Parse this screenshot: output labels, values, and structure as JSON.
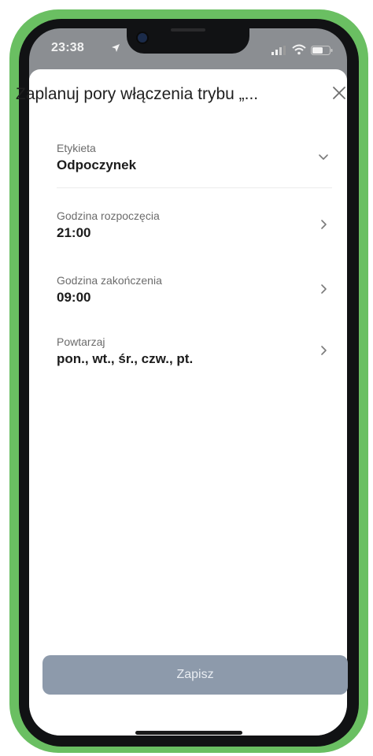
{
  "status_bar": {
    "time": "23:38"
  },
  "sheet": {
    "title": "Zaplanuj pory włączenia trybu „..."
  },
  "fields": [
    {
      "label": "Etykieta",
      "value": "Odpoczynek"
    },
    {
      "label": "Godzina rozpoczęcia",
      "value": "21:00"
    },
    {
      "label": "Godzina zakończenia",
      "value": "09:00"
    },
    {
      "label": "Powtarzaj",
      "value": "pon., wt., śr., czw., pt."
    }
  ],
  "save_button": {
    "label": "Zapisz"
  },
  "colors": {
    "frame": "#6abf62",
    "save_button": "#8d9aab"
  }
}
